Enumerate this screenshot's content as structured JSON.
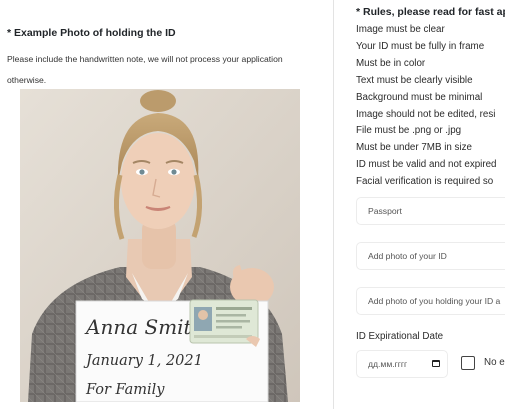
{
  "example": {
    "title": "* Example Photo of holding the ID",
    "description": "Please include the handwritten note, we will not process your application otherwise."
  },
  "note": {
    "line1": "Anna Smith",
    "line2": "January 1, 2021",
    "line3": "For Family"
  },
  "rules": {
    "title": "* Rules, please read for fast app",
    "items": [
      "Image must be clear",
      "Your ID must be fully in frame",
      "Must be in color",
      "Text must be clearly visible",
      "Background must be minimal",
      "Image should not be edited, resi",
      "File must be .png or .jpg",
      "Must be under 7MB in size",
      "ID must be valid and not expired",
      "Facial verification is required so"
    ]
  },
  "form": {
    "passport_placeholder": "Passport",
    "id_photo_placeholder": "Add photo of your ID",
    "holding_photo_placeholder": "Add photo of you holding your ID a",
    "expiration_label": "ID Expirational Date",
    "date_placeholder": "дд.мм.гггг",
    "checkbox_label": "No e"
  }
}
